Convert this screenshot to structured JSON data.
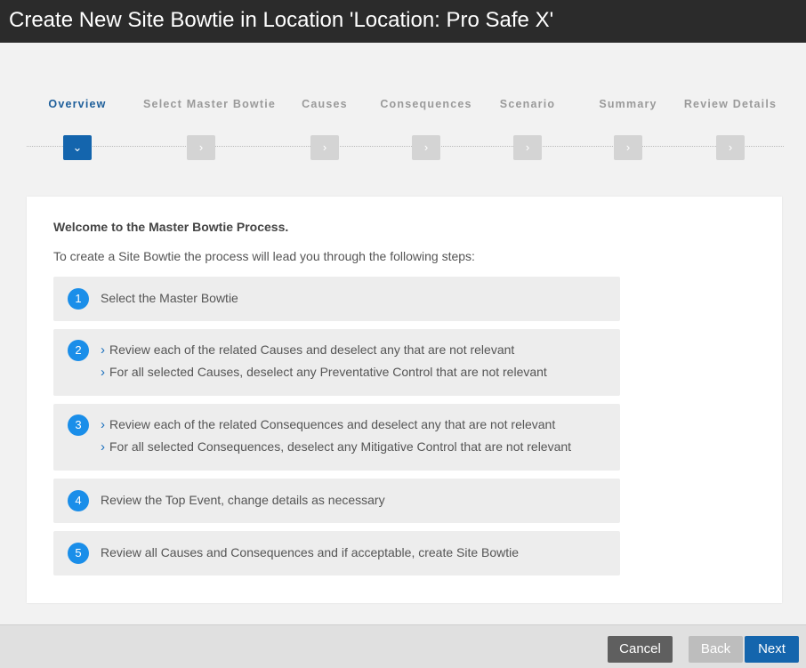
{
  "window": {
    "title": "Create New Site Bowtie in Location 'Location: Pro Safe X'"
  },
  "steps": [
    {
      "label": "Overview",
      "icon": "chevron-down-icon"
    },
    {
      "label": "Select Master Bowtie",
      "icon": "chevron-right-icon"
    },
    {
      "label": "Causes",
      "icon": "chevron-right-icon"
    },
    {
      "label": "Consequences",
      "icon": "chevron-right-icon"
    },
    {
      "label": "Scenario",
      "icon": "chevron-right-icon"
    },
    {
      "label": "Summary",
      "icon": "chevron-right-icon"
    },
    {
      "label": "Review Details",
      "icon": "chevron-right-icon"
    }
  ],
  "content": {
    "heading": "Welcome to the Master Bowtie Process.",
    "intro": "To create a Site Bowtie the process will lead you through the following steps:",
    "items": [
      {
        "number": "1",
        "lines": [
          "Select the Master Bowtie"
        ]
      },
      {
        "number": "2",
        "lines": [
          "Review each of the related Causes and deselect any that are not relevant",
          "For all selected Causes, deselect any Preventative Control that are not relevant"
        ]
      },
      {
        "number": "3",
        "lines": [
          "Review each of the related Consequences and deselect any that are not relevant",
          "For all selected Consequences, deselect any Mitigative Control that are not relevant"
        ]
      },
      {
        "number": "4",
        "lines": [
          "Review the Top Event, change details as necessary"
        ]
      },
      {
        "number": "5",
        "lines": [
          "Review all Causes and Consequences and if acceptable, create Site Bowtie"
        ]
      }
    ]
  },
  "footer": {
    "cancel_label": "Cancel",
    "back_label": "Back",
    "next_label": "Next"
  },
  "colors": {
    "accent": "#1465ad",
    "badge": "#1a8ee9",
    "title_bar": "#2b2b2b"
  }
}
